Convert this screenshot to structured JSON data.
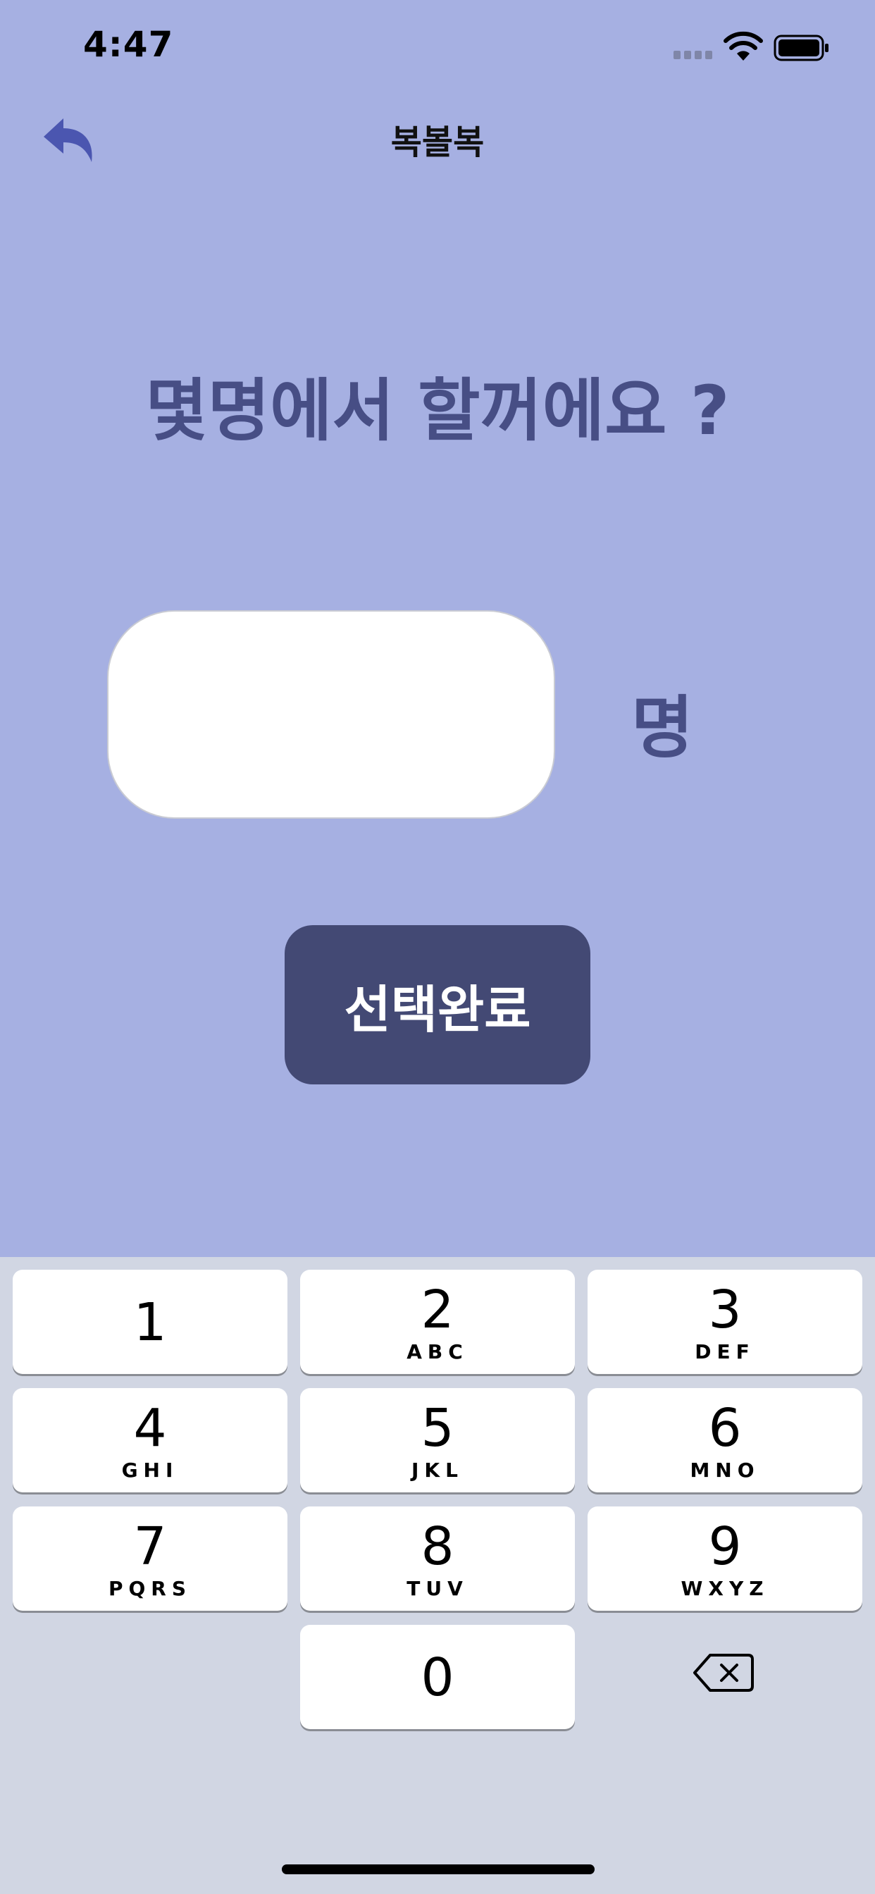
{
  "status_bar": {
    "time": "4:47"
  },
  "nav": {
    "title": "복볼복"
  },
  "question": "몇명에서 할꺼에요 ?",
  "count_input": {
    "value": "",
    "placeholder": ""
  },
  "unit_label": "명",
  "confirm_button": "선택완료",
  "keypad": {
    "k1": {
      "num": "1",
      "letters": ""
    },
    "k2": {
      "num": "2",
      "letters": "ABC"
    },
    "k3": {
      "num": "3",
      "letters": "DEF"
    },
    "k4": {
      "num": "4",
      "letters": "GHI"
    },
    "k5": {
      "num": "5",
      "letters": "JKL"
    },
    "k6": {
      "num": "6",
      "letters": "MNO"
    },
    "k7": {
      "num": "7",
      "letters": "PQRS"
    },
    "k8": {
      "num": "8",
      "letters": "TUV"
    },
    "k9": {
      "num": "9",
      "letters": "WXYZ"
    },
    "k0": {
      "num": "0",
      "letters": ""
    }
  },
  "colors": {
    "background": "#a6b0e2",
    "accent_text": "#474e85",
    "button": "#434974",
    "back_icon": "#4b56b0",
    "keyboard": "#d1d6e3"
  },
  "icons": [
    "back-arrow-icon",
    "cellular-signal-icon",
    "wifi-icon",
    "battery-icon",
    "delete-backspace-icon"
  ]
}
